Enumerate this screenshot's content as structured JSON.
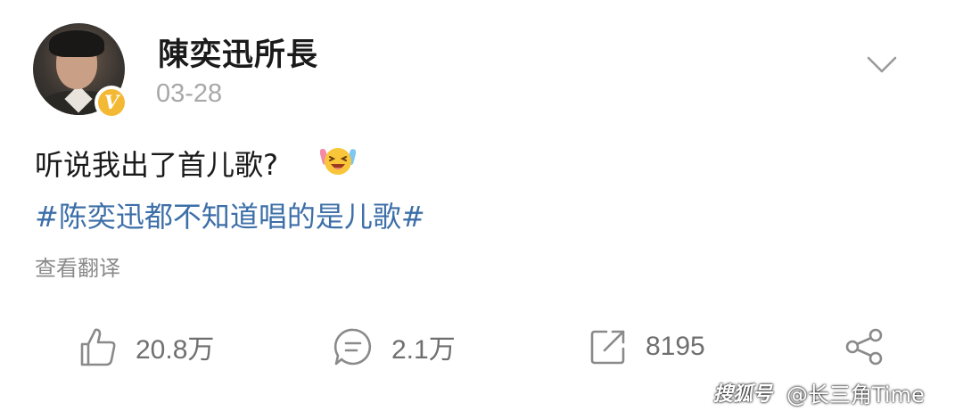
{
  "post": {
    "username": "陳奕迅所長",
    "date": "03-28",
    "verified_badge": "V",
    "text": "听说我出了首儿歌?",
    "hashtag": "#陈奕迅都不知道唱的是儿歌#",
    "translate_label": "查看翻译"
  },
  "actions": {
    "likes": "20.8万",
    "comments": "2.1万",
    "reposts": "8195"
  },
  "icons": {
    "more": "chevron-down-icon",
    "like": "thumbs-up-icon",
    "comment": "comment-icon",
    "repost": "repost-icon",
    "share": "share-icon",
    "emoji": "laughing-cheering-emoji"
  },
  "watermark": {
    "brand": "搜狐号",
    "text": "@长三角Time"
  },
  "colors": {
    "hashtag": "#3d6fa8",
    "verified": "#f3b935",
    "secondary_text": "#a8a8a8",
    "action_gray": "#6f6f6f"
  }
}
